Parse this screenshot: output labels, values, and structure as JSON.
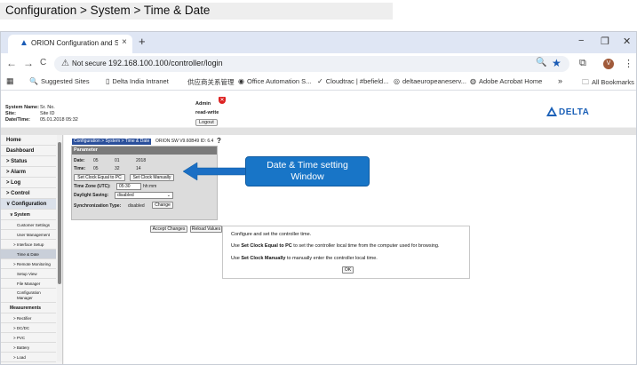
{
  "page_title": "Configuration > System > Time & Date",
  "browser": {
    "tab_title": "ORION Configuration and Sup",
    "tab_close": "×",
    "new_tab": "+",
    "win_min": "−",
    "win_max": "❐",
    "win_close": "✕",
    "back": "←",
    "forward": "→",
    "reload": "C",
    "not_secure": "Not secure",
    "url": "192.168.100.100/controller/login",
    "avatar_letter": "V",
    "bookmarks": [
      {
        "label": "Suggested Sites",
        "icon": "🔍"
      },
      {
        "label": "Delta India Intranet",
        "icon": "▯"
      },
      {
        "label": "供应商关系管理",
        "icon": ""
      },
      {
        "label": "Office Automation S...",
        "icon": "◉"
      },
      {
        "label": "Cloudtrac | #befield...",
        "icon": "✓"
      },
      {
        "label": "deltaeuropeaneserv...",
        "icon": "◎"
      },
      {
        "label": "Adobe Acrobat Home",
        "icon": "◍"
      }
    ],
    "all_bookmarks": "All Bookmarks",
    "more_bookmarks": "»"
  },
  "header": {
    "system_name_label": "System Name:",
    "system_name_value": "Sr. No.",
    "site_label": "Site:",
    "site_value": "Site ID",
    "datetime_label": "Date/Time:",
    "datetime_value": "05.01.2018 05:32",
    "user": "Admin",
    "access": "read-write",
    "logout": "Logout",
    "logo_text": "DELTA"
  },
  "sidebar": {
    "items": [
      {
        "label": "Home",
        "level": "l0"
      },
      {
        "label": "Dashboard",
        "level": "l0"
      },
      {
        "label": "> Status",
        "level": "l0"
      },
      {
        "label": "> Alarm",
        "level": "l0"
      },
      {
        "label": "> Log",
        "level": "l0"
      },
      {
        "label": "> Control",
        "level": "l0"
      },
      {
        "label": "∨ Configuration",
        "level": "l0",
        "state": "active"
      },
      {
        "label": "∨ System",
        "level": "l1"
      },
      {
        "label": "Customer Settings",
        "level": "l3"
      },
      {
        "label": "User Management",
        "level": "l3"
      },
      {
        "label": "> Interface Setup",
        "level": "l2"
      },
      {
        "label": "Time & Date",
        "level": "l3",
        "state": "selected"
      },
      {
        "label": "> Remote Monitoring",
        "level": "l2"
      },
      {
        "label": "Setup View",
        "level": "l3"
      },
      {
        "label": "File Manager",
        "level": "l3"
      },
      {
        "label": "Configuration Manager",
        "level": "l3"
      },
      {
        "label": "Measurements",
        "level": "l1"
      },
      {
        "label": "> Rectifier",
        "level": "l2"
      },
      {
        "label": "> DC/DC",
        "level": "l2"
      },
      {
        "label": "> PVC",
        "level": "l2"
      },
      {
        "label": "> Battery",
        "level": "l2"
      },
      {
        "label": "> Load",
        "level": "l2"
      }
    ]
  },
  "content": {
    "breadcrumb": "Configuration > System > Time & Date",
    "version": "ORION SW V9.60B49  ID: 6.4",
    "help": "?",
    "panel": {
      "title": "Parameter",
      "date_label": "Date:",
      "date_day": "05",
      "date_month": "01",
      "date_year": "2018",
      "time_label": "Time:",
      "time_hour": "05",
      "time_min": "32",
      "time_sec": "14",
      "set_clock_pc": "Set Clock Equal to PC",
      "set_clock_manual": "Set Clock Manually",
      "tz_label": "Time Zone (UTC):",
      "tz_value": "05:30",
      "tz_unit": "hh:mm",
      "dst_label": "Daylight Saving:",
      "dst_value": "disabled",
      "sync_label": "Synchronization Type:",
      "sync_value": "disabled",
      "change": "Change"
    },
    "accept": "Accept Changes",
    "reload": "Reload Values"
  },
  "callout": {
    "line1": "Date & Time setting",
    "line2": "Window"
  },
  "info": {
    "line1": "Configure and set the controller time.",
    "line2_pre": "Use ",
    "line2_bold": "Set Clock Equal to PC",
    "line2_post": " to set the controller local time from the computer used for browsing.",
    "line3_pre": "Use ",
    "line3_bold": "Set Clock Manually",
    "line3_post": " to manually enter the controller local time.",
    "ok": "OK"
  }
}
